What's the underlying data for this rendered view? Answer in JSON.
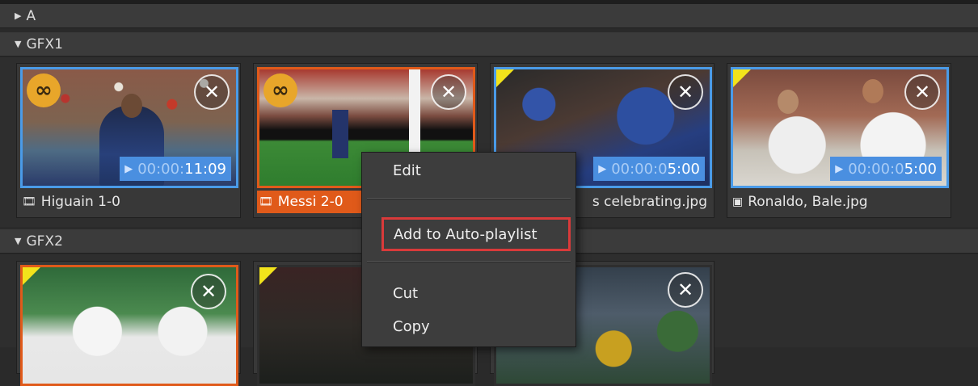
{
  "groups": {
    "a": {
      "label": "A",
      "arrow": "right-triangle-icon"
    },
    "gfx1": {
      "label": "GFX1",
      "arrow": "down-triangle-icon"
    },
    "gfx2": {
      "label": "GFX2",
      "arrow": "down-triangle-icon"
    }
  },
  "gfx1_items": [
    {
      "name": "Higuain 1-0",
      "type": "video",
      "duration_dim": "00:00:",
      "duration": "11:09",
      "loop": true
    },
    {
      "name": "Messi 2-0",
      "type": "video",
      "loop": true,
      "selected": true
    },
    {
      "name": "s celebrating.jpg",
      "type": "image",
      "duration_dim": "00:00:0",
      "duration": "5:00",
      "new_marker": true
    },
    {
      "name": "Ronaldo, Bale.jpg",
      "type": "image",
      "duration_dim": "00:00:0",
      "duration": "5:00",
      "new_marker": true
    }
  ],
  "context_menu": {
    "items": [
      "Edit",
      "Add to Auto-playlist",
      "Cut",
      "Copy"
    ],
    "highlighted": "Add to Auto-playlist",
    "highlight_color": "#d93a3a"
  },
  "colors": {
    "selected": "#e05a1a",
    "border": "#4a9be8",
    "marker": "#f2e31b",
    "loop": "#e8a62a"
  }
}
